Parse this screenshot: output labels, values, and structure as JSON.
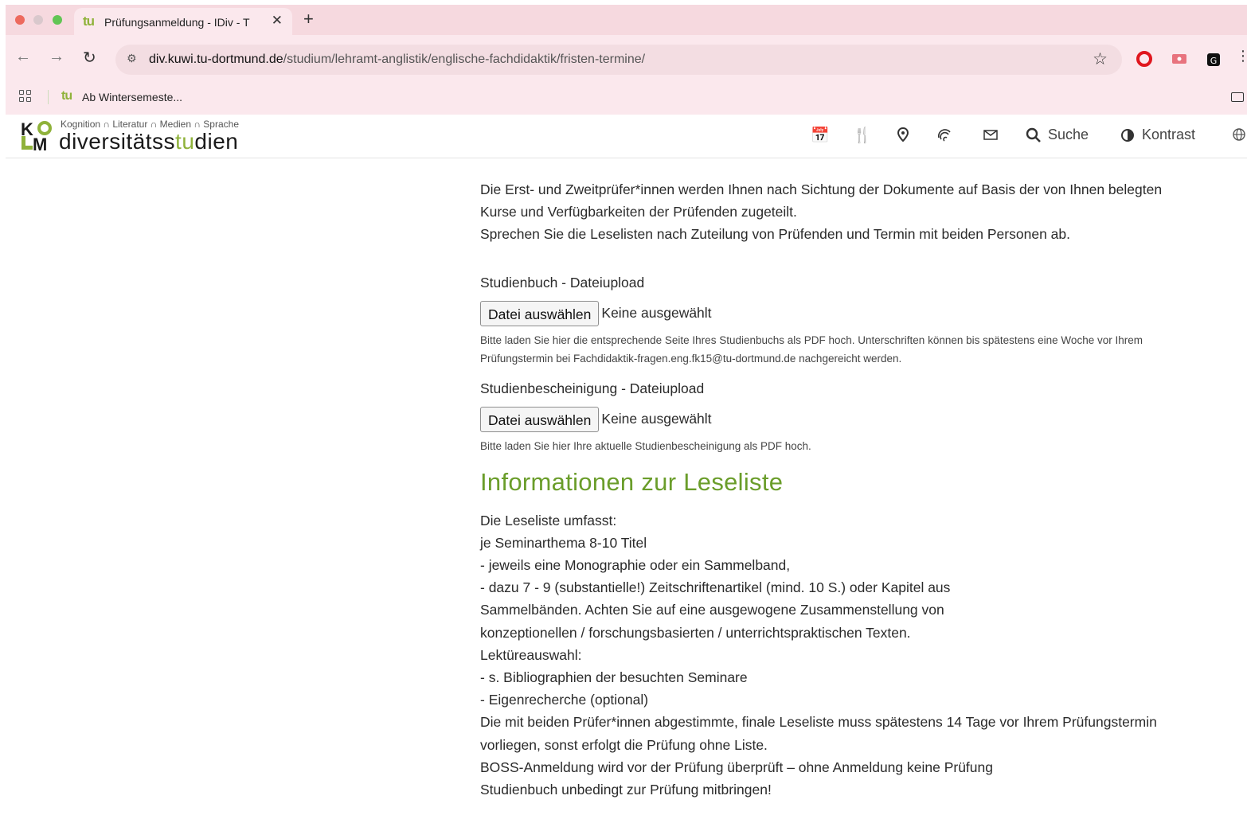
{
  "browser": {
    "tab": {
      "title": "Prüfungsanmeldung - IDiv - T",
      "favicon_text": "tu",
      "close_icon": "close-icon"
    },
    "new_tab_symbol": "+",
    "address": {
      "host": "div.kuwi.tu-dortmund.de",
      "path": "/studium/lehramt-anglistik/englische-fachdidaktik/fristen-termine/"
    },
    "bookmarks": [
      {
        "favicon_text": "tu",
        "label": "Ab Wintersemeste..."
      }
    ],
    "window_controls": [
      "#ed6a5e",
      "#d9c8cc",
      "#61c554"
    ]
  },
  "site": {
    "logo": {
      "tagline": "Kognition ∩ Literatur ∩ Medien ∩ Sprache",
      "name_part1": "diversitätss",
      "name_part2": "tu",
      "name_part3": "dien"
    },
    "nav": {
      "search_label": "Suche",
      "contrast_label": "Kontrast"
    },
    "accent_color": "#6a9d2a"
  },
  "content": {
    "intro": [
      "Die Erst- und Zweitprüfer*innen werden Ihnen nach Sichtung der Dokumente auf Basis der von Ihnen belegten",
      "Kurse und Verfügbarkeiten der Prüfenden zugeteilt.",
      "Sprechen Sie die Leselisten nach Zuteilung von Prüfenden und Termin mit beiden Personen ab."
    ],
    "upload1": {
      "label": "Studienbuch - Dateiupload",
      "button": "Datei auswählen",
      "status": "Keine ausgewählt",
      "help": [
        "Bitte laden Sie hier die entsprechende Seite Ihres Studienbuchs als PDF hoch. Unterschriften können bis spätestens eine Woche vor Ihrem",
        "Prüfungstermin bei Fachdidaktik-fragen.eng.fk15@tu-dortmund.de nachgereicht werden."
      ]
    },
    "upload2": {
      "label": "Studienbescheinigung - Dateiupload",
      "button": "Datei auswählen",
      "status": "Keine ausgewählt",
      "help": "Bitte laden Sie hier Ihre aktuelle Studienbescheinigung als PDF hoch."
    },
    "heading": "Informationen zur Leseliste",
    "leseliste": [
      "Die Leseliste umfasst:",
      "je Seminarthema 8-10 Titel",
      "- jeweils eine Monographie oder ein Sammelband,",
      "- dazu 7 - 9 (substantielle!) Zeitschriftenartikel (mind. 10 S.) oder Kapitel aus",
      "Sammelbänden. Achten Sie auf eine ausgewogene Zusammenstellung von",
      "konzeptionellen / forschungsbasierten / unterrichtspraktischen Texten.",
      "Lektüreauswahl:",
      "- s. Bibliographien der besuchten Seminare",
      "- Eigenrecherche (optional)",
      "Die mit beiden Prüfer*innen abgestimmte, finale Leseliste muss spätestens 14 Tage vor Ihrem Prüfungstermin",
      "vorliegen, sonst erfolgt die Prüfung ohne Liste.",
      "BOSS-Anmeldung wird vor der Prüfung überprüft – ohne Anmeldung keine Prüfung",
      "Studienbuch unbedingt zur Prüfung mitbringen!"
    ]
  }
}
